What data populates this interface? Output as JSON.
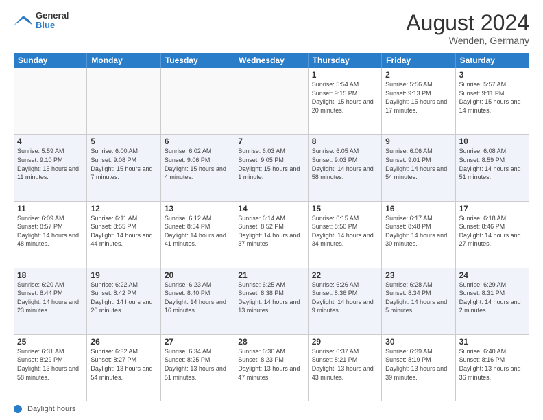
{
  "header": {
    "logo_general": "General",
    "logo_blue": "Blue",
    "month_year": "August 2024",
    "location": "Wenden, Germany"
  },
  "days_of_week": [
    "Sunday",
    "Monday",
    "Tuesday",
    "Wednesday",
    "Thursday",
    "Friday",
    "Saturday"
  ],
  "footer": {
    "label": "Daylight hours"
  },
  "weeks": [
    {
      "cells": [
        {
          "day": "",
          "empty": true
        },
        {
          "day": "",
          "empty": true
        },
        {
          "day": "",
          "empty": true
        },
        {
          "day": "",
          "empty": true
        },
        {
          "day": "1",
          "sunrise": "Sunrise: 5:54 AM",
          "sunset": "Sunset: 9:15 PM",
          "daylight": "Daylight: 15 hours and 20 minutes."
        },
        {
          "day": "2",
          "sunrise": "Sunrise: 5:56 AM",
          "sunset": "Sunset: 9:13 PM",
          "daylight": "Daylight: 15 hours and 17 minutes."
        },
        {
          "day": "3",
          "sunrise": "Sunrise: 5:57 AM",
          "sunset": "Sunset: 9:11 PM",
          "daylight": "Daylight: 15 hours and 14 minutes."
        }
      ]
    },
    {
      "cells": [
        {
          "day": "4",
          "sunrise": "Sunrise: 5:59 AM",
          "sunset": "Sunset: 9:10 PM",
          "daylight": "Daylight: 15 hours and 11 minutes."
        },
        {
          "day": "5",
          "sunrise": "Sunrise: 6:00 AM",
          "sunset": "Sunset: 9:08 PM",
          "daylight": "Daylight: 15 hours and 7 minutes."
        },
        {
          "day": "6",
          "sunrise": "Sunrise: 6:02 AM",
          "sunset": "Sunset: 9:06 PM",
          "daylight": "Daylight: 15 hours and 4 minutes."
        },
        {
          "day": "7",
          "sunrise": "Sunrise: 6:03 AM",
          "sunset": "Sunset: 9:05 PM",
          "daylight": "Daylight: 15 hours and 1 minute."
        },
        {
          "day": "8",
          "sunrise": "Sunrise: 6:05 AM",
          "sunset": "Sunset: 9:03 PM",
          "daylight": "Daylight: 14 hours and 58 minutes."
        },
        {
          "day": "9",
          "sunrise": "Sunrise: 6:06 AM",
          "sunset": "Sunset: 9:01 PM",
          "daylight": "Daylight: 14 hours and 54 minutes."
        },
        {
          "day": "10",
          "sunrise": "Sunrise: 6:08 AM",
          "sunset": "Sunset: 8:59 PM",
          "daylight": "Daylight: 14 hours and 51 minutes."
        }
      ]
    },
    {
      "cells": [
        {
          "day": "11",
          "sunrise": "Sunrise: 6:09 AM",
          "sunset": "Sunset: 8:57 PM",
          "daylight": "Daylight: 14 hours and 48 minutes."
        },
        {
          "day": "12",
          "sunrise": "Sunrise: 6:11 AM",
          "sunset": "Sunset: 8:55 PM",
          "daylight": "Daylight: 14 hours and 44 minutes."
        },
        {
          "day": "13",
          "sunrise": "Sunrise: 6:12 AM",
          "sunset": "Sunset: 8:54 PM",
          "daylight": "Daylight: 14 hours and 41 minutes."
        },
        {
          "day": "14",
          "sunrise": "Sunrise: 6:14 AM",
          "sunset": "Sunset: 8:52 PM",
          "daylight": "Daylight: 14 hours and 37 minutes."
        },
        {
          "day": "15",
          "sunrise": "Sunrise: 6:15 AM",
          "sunset": "Sunset: 8:50 PM",
          "daylight": "Daylight: 14 hours and 34 minutes."
        },
        {
          "day": "16",
          "sunrise": "Sunrise: 6:17 AM",
          "sunset": "Sunset: 8:48 PM",
          "daylight": "Daylight: 14 hours and 30 minutes."
        },
        {
          "day": "17",
          "sunrise": "Sunrise: 6:18 AM",
          "sunset": "Sunset: 8:46 PM",
          "daylight": "Daylight: 14 hours and 27 minutes."
        }
      ]
    },
    {
      "cells": [
        {
          "day": "18",
          "sunrise": "Sunrise: 6:20 AM",
          "sunset": "Sunset: 8:44 PM",
          "daylight": "Daylight: 14 hours and 23 minutes."
        },
        {
          "day": "19",
          "sunrise": "Sunrise: 6:22 AM",
          "sunset": "Sunset: 8:42 PM",
          "daylight": "Daylight: 14 hours and 20 minutes."
        },
        {
          "day": "20",
          "sunrise": "Sunrise: 6:23 AM",
          "sunset": "Sunset: 8:40 PM",
          "daylight": "Daylight: 14 hours and 16 minutes."
        },
        {
          "day": "21",
          "sunrise": "Sunrise: 6:25 AM",
          "sunset": "Sunset: 8:38 PM",
          "daylight": "Daylight: 14 hours and 13 minutes."
        },
        {
          "day": "22",
          "sunrise": "Sunrise: 6:26 AM",
          "sunset": "Sunset: 8:36 PM",
          "daylight": "Daylight: 14 hours and 9 minutes."
        },
        {
          "day": "23",
          "sunrise": "Sunrise: 6:28 AM",
          "sunset": "Sunset: 8:34 PM",
          "daylight": "Daylight: 14 hours and 5 minutes."
        },
        {
          "day": "24",
          "sunrise": "Sunrise: 6:29 AM",
          "sunset": "Sunset: 8:31 PM",
          "daylight": "Daylight: 14 hours and 2 minutes."
        }
      ]
    },
    {
      "cells": [
        {
          "day": "25",
          "sunrise": "Sunrise: 6:31 AM",
          "sunset": "Sunset: 8:29 PM",
          "daylight": "Daylight: 13 hours and 58 minutes."
        },
        {
          "day": "26",
          "sunrise": "Sunrise: 6:32 AM",
          "sunset": "Sunset: 8:27 PM",
          "daylight": "Daylight: 13 hours and 54 minutes."
        },
        {
          "day": "27",
          "sunrise": "Sunrise: 6:34 AM",
          "sunset": "Sunset: 8:25 PM",
          "daylight": "Daylight: 13 hours and 51 minutes."
        },
        {
          "day": "28",
          "sunrise": "Sunrise: 6:36 AM",
          "sunset": "Sunset: 8:23 PM",
          "daylight": "Daylight: 13 hours and 47 minutes."
        },
        {
          "day": "29",
          "sunrise": "Sunrise: 6:37 AM",
          "sunset": "Sunset: 8:21 PM",
          "daylight": "Daylight: 13 hours and 43 minutes."
        },
        {
          "day": "30",
          "sunrise": "Sunrise: 6:39 AM",
          "sunset": "Sunset: 8:19 PM",
          "daylight": "Daylight: 13 hours and 39 minutes."
        },
        {
          "day": "31",
          "sunrise": "Sunrise: 6:40 AM",
          "sunset": "Sunset: 8:16 PM",
          "daylight": "Daylight: 13 hours and 36 minutes."
        }
      ]
    }
  ]
}
